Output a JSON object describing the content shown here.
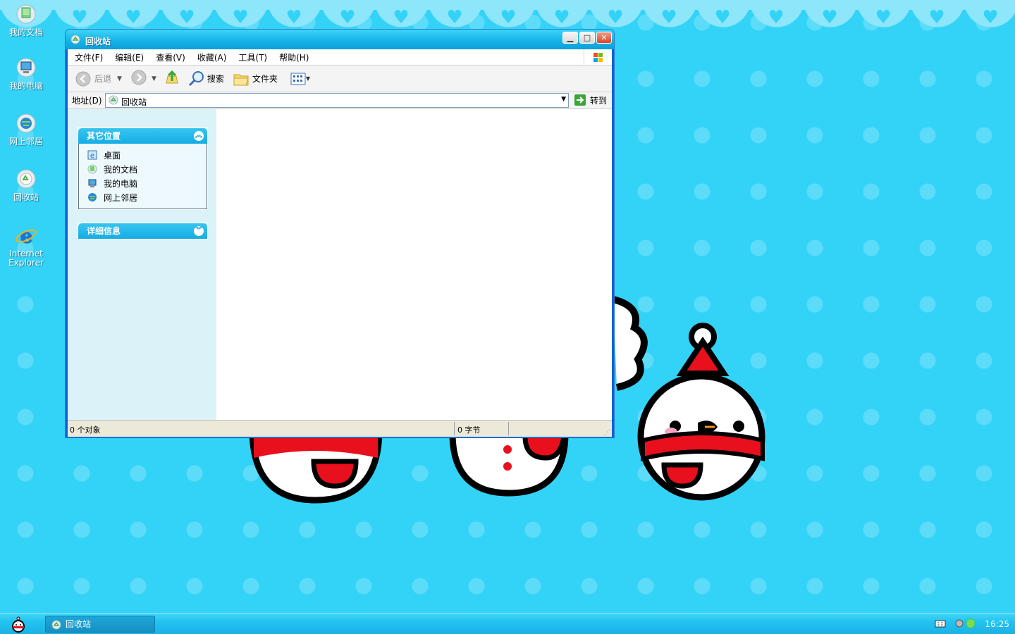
{
  "desktop": {
    "icons": [
      {
        "label": "我的文档"
      },
      {
        "label": "我的电脑"
      },
      {
        "label": "网上邻居"
      },
      {
        "label": "回收站"
      },
      {
        "label_line1": "Internet",
        "label_line2": "Explorer"
      }
    ]
  },
  "window": {
    "title": "回收站",
    "controls": {
      "minimize": "▁",
      "maximize": "□",
      "close": "✕"
    },
    "menu": [
      "文件(F)",
      "编辑(E)",
      "查看(V)",
      "收藏(A)",
      "工具(T)",
      "帮助(H)"
    ],
    "toolbar": {
      "back_label": "后退",
      "search_label": "搜索",
      "folders_label": "文件夹"
    },
    "address": {
      "label": "地址(D)",
      "value": "回收站",
      "go_label": "转到"
    },
    "left_pane": {
      "other_places": {
        "title": "其它位置",
        "items": [
          "桌面",
          "我的文档",
          "我的电脑",
          "网上邻居"
        ]
      },
      "details": {
        "title": "详细信息"
      }
    },
    "status": {
      "objects": "0 个对象",
      "size": "0 字节"
    }
  },
  "taskbar": {
    "task_label": "回收站",
    "clock": "16:25"
  },
  "colors": {
    "desktop_bg": "#33d3f7",
    "title_blue": "#13b1e7",
    "snowman_red": "#e8101c"
  }
}
